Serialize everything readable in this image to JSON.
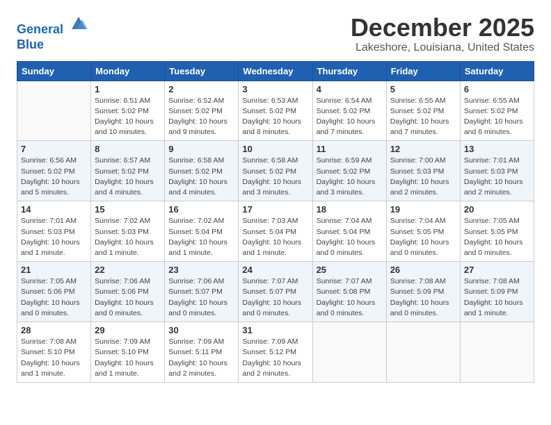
{
  "header": {
    "logo_line1": "General",
    "logo_line2": "Blue",
    "title": "December 2025",
    "subtitle": "Lakeshore, Louisiana, United States"
  },
  "weekdays": [
    "Sunday",
    "Monday",
    "Tuesday",
    "Wednesday",
    "Thursday",
    "Friday",
    "Saturday"
  ],
  "weeks": [
    [
      {
        "day": "",
        "detail": ""
      },
      {
        "day": "1",
        "detail": "Sunrise: 6:51 AM\nSunset: 5:02 PM\nDaylight: 10 hours\nand 10 minutes."
      },
      {
        "day": "2",
        "detail": "Sunrise: 6:52 AM\nSunset: 5:02 PM\nDaylight: 10 hours\nand 9 minutes."
      },
      {
        "day": "3",
        "detail": "Sunrise: 6:53 AM\nSunset: 5:02 PM\nDaylight: 10 hours\nand 8 minutes."
      },
      {
        "day": "4",
        "detail": "Sunrise: 6:54 AM\nSunset: 5:02 PM\nDaylight: 10 hours\nand 7 minutes."
      },
      {
        "day": "5",
        "detail": "Sunrise: 6:55 AM\nSunset: 5:02 PM\nDaylight: 10 hours\nand 7 minutes."
      },
      {
        "day": "6",
        "detail": "Sunrise: 6:55 AM\nSunset: 5:02 PM\nDaylight: 10 hours\nand 6 minutes."
      }
    ],
    [
      {
        "day": "7",
        "detail": "Sunrise: 6:56 AM\nSunset: 5:02 PM\nDaylight: 10 hours\nand 5 minutes."
      },
      {
        "day": "8",
        "detail": "Sunrise: 6:57 AM\nSunset: 5:02 PM\nDaylight: 10 hours\nand 4 minutes."
      },
      {
        "day": "9",
        "detail": "Sunrise: 6:58 AM\nSunset: 5:02 PM\nDaylight: 10 hours\nand 4 minutes."
      },
      {
        "day": "10",
        "detail": "Sunrise: 6:58 AM\nSunset: 5:02 PM\nDaylight: 10 hours\nand 3 minutes."
      },
      {
        "day": "11",
        "detail": "Sunrise: 6:59 AM\nSunset: 5:02 PM\nDaylight: 10 hours\nand 3 minutes."
      },
      {
        "day": "12",
        "detail": "Sunrise: 7:00 AM\nSunset: 5:03 PM\nDaylight: 10 hours\nand 2 minutes."
      },
      {
        "day": "13",
        "detail": "Sunrise: 7:01 AM\nSunset: 5:03 PM\nDaylight: 10 hours\nand 2 minutes."
      }
    ],
    [
      {
        "day": "14",
        "detail": "Sunrise: 7:01 AM\nSunset: 5:03 PM\nDaylight: 10 hours\nand 1 minute."
      },
      {
        "day": "15",
        "detail": "Sunrise: 7:02 AM\nSunset: 5:03 PM\nDaylight: 10 hours\nand 1 minute."
      },
      {
        "day": "16",
        "detail": "Sunrise: 7:02 AM\nSunset: 5:04 PM\nDaylight: 10 hours\nand 1 minute."
      },
      {
        "day": "17",
        "detail": "Sunrise: 7:03 AM\nSunset: 5:04 PM\nDaylight: 10 hours\nand 1 minute."
      },
      {
        "day": "18",
        "detail": "Sunrise: 7:04 AM\nSunset: 5:04 PM\nDaylight: 10 hours\nand 0 minutes."
      },
      {
        "day": "19",
        "detail": "Sunrise: 7:04 AM\nSunset: 5:05 PM\nDaylight: 10 hours\nand 0 minutes."
      },
      {
        "day": "20",
        "detail": "Sunrise: 7:05 AM\nSunset: 5:05 PM\nDaylight: 10 hours\nand 0 minutes."
      }
    ],
    [
      {
        "day": "21",
        "detail": "Sunrise: 7:05 AM\nSunset: 5:06 PM\nDaylight: 10 hours\nand 0 minutes."
      },
      {
        "day": "22",
        "detail": "Sunrise: 7:06 AM\nSunset: 5:06 PM\nDaylight: 10 hours\nand 0 minutes."
      },
      {
        "day": "23",
        "detail": "Sunrise: 7:06 AM\nSunset: 5:07 PM\nDaylight: 10 hours\nand 0 minutes."
      },
      {
        "day": "24",
        "detail": "Sunrise: 7:07 AM\nSunset: 5:07 PM\nDaylight: 10 hours\nand 0 minutes."
      },
      {
        "day": "25",
        "detail": "Sunrise: 7:07 AM\nSunset: 5:08 PM\nDaylight: 10 hours\nand 0 minutes."
      },
      {
        "day": "26",
        "detail": "Sunrise: 7:08 AM\nSunset: 5:09 PM\nDaylight: 10 hours\nand 0 minutes."
      },
      {
        "day": "27",
        "detail": "Sunrise: 7:08 AM\nSunset: 5:09 PM\nDaylight: 10 hours\nand 1 minute."
      }
    ],
    [
      {
        "day": "28",
        "detail": "Sunrise: 7:08 AM\nSunset: 5:10 PM\nDaylight: 10 hours\nand 1 minute."
      },
      {
        "day": "29",
        "detail": "Sunrise: 7:09 AM\nSunset: 5:10 PM\nDaylight: 10 hours\nand 1 minute."
      },
      {
        "day": "30",
        "detail": "Sunrise: 7:09 AM\nSunset: 5:11 PM\nDaylight: 10 hours\nand 2 minutes."
      },
      {
        "day": "31",
        "detail": "Sunrise: 7:09 AM\nSunset: 5:12 PM\nDaylight: 10 hours\nand 2 minutes."
      },
      {
        "day": "",
        "detail": ""
      },
      {
        "day": "",
        "detail": ""
      },
      {
        "day": "",
        "detail": ""
      }
    ]
  ]
}
